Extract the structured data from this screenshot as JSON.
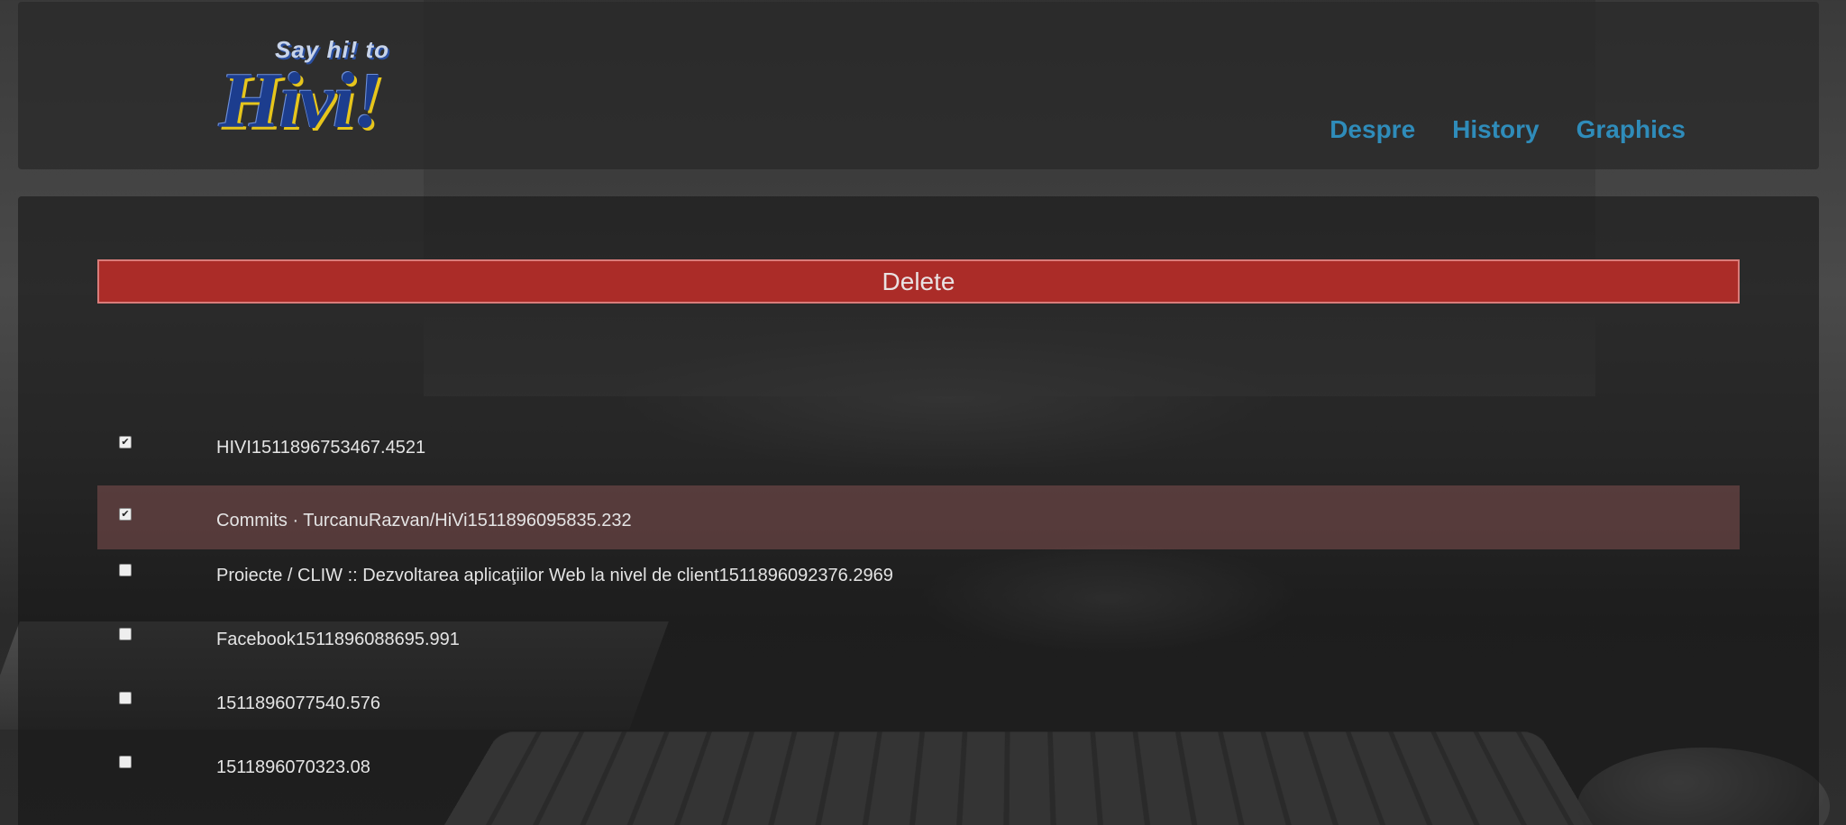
{
  "header": {
    "logo": {
      "tagline": "Say hi! to",
      "brand": "Hivi!"
    },
    "nav": [
      {
        "label": "Despre"
      },
      {
        "label": "History"
      },
      {
        "label": "Graphics"
      }
    ]
  },
  "main": {
    "delete_label": "Delete",
    "items": [
      {
        "label": "HIVI1511896753467.4521",
        "checked": true,
        "highlighted": false
      },
      {
        "label": "Commits · TurcanuRazvan/HiVi1511896095835.232",
        "checked": true,
        "highlighted": true
      },
      {
        "label": "Proiecte / CLIW :: Dezvoltarea aplicaţiilor Web la nivel de client1511896092376.2969",
        "checked": false,
        "highlighted": false
      },
      {
        "label": "Facebook1511896088695.991",
        "checked": false,
        "highlighted": false
      },
      {
        "label": "1511896077540.576",
        "checked": false,
        "highlighted": false
      },
      {
        "label": "1511896070323.08",
        "checked": false,
        "highlighted": false
      }
    ]
  },
  "colors": {
    "nav_link": "#2f8cba",
    "delete_bg": "#c82d28",
    "selected_row": "#825050"
  }
}
